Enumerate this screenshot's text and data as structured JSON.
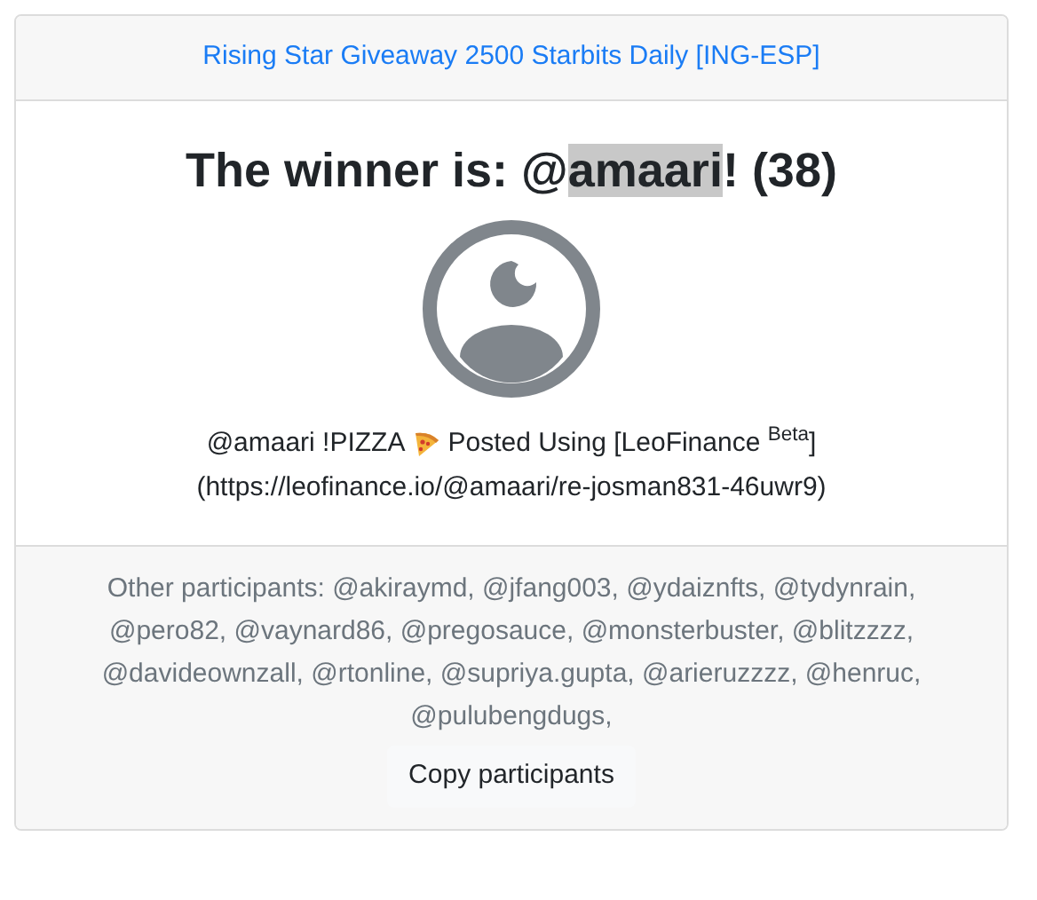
{
  "header": {
    "title": "Rising Star Giveaway 2500 Starbits Daily [ING-ESP]"
  },
  "winner_heading": {
    "before": "The winner is: @",
    "selected_text": "amaari",
    "after": "! (38)"
  },
  "comment": {
    "start": "@amaari !PIZZA",
    "end": "Posted Using [LeoFinance $^{Beta}$]",
    "link": "(https://leofinance.io/@amaari/re-josman831-46uwr9)"
  },
  "footer": {
    "participants": "Other participants: @akiraymd, @jfang003, @ydaiznfts, @tydynrain, @pero82, @vaynard86, @pregosauce, @monsterbuster, @blitzzzz, @davideownzall, @rtonline, @supriya.gupta, @arieruzzzz, @henruc, @pulubengdugs,",
    "button": "Copy participants"
  }
}
